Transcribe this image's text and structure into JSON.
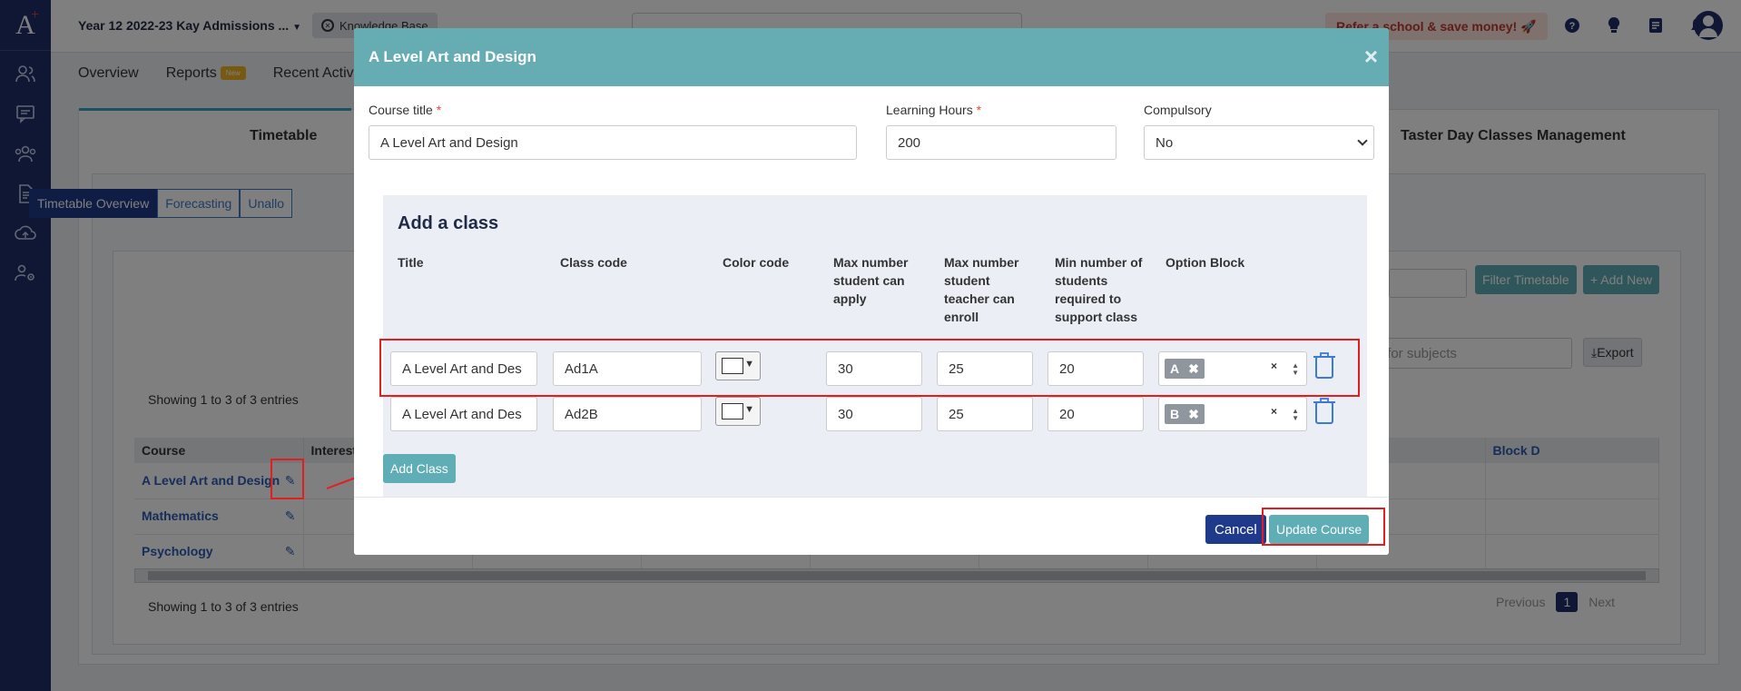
{
  "app": {
    "logo": "A",
    "logo_plus": "+"
  },
  "topbar": {
    "title": "Year 12 2022-23 Kay Admissions ...",
    "knowledge_base": "Knowledge Base",
    "refer": "Refer a school & save money! 🚀"
  },
  "nav": {
    "tabs": [
      "Overview",
      "Reports",
      "Recent Activ"
    ],
    "reports_badge": "New"
  },
  "background": {
    "tab_left": "Timetable",
    "tab_right": "Taster Day Classes Management",
    "subtabs": [
      "Timetable Overview",
      "Forecasting",
      "Unallo"
    ],
    "filter_button": "Filter Timetable",
    "add_new_button": "+ Add New",
    "subject_filter_placeholder": "r for subjects",
    "export_button": "Export",
    "showing": "Showing 1 to 3 of 3 entries",
    "columns": [
      "Course",
      "Interest",
      "Block D"
    ],
    "courses": [
      "A Level Art and Design",
      "Mathematics",
      "Psychology"
    ],
    "pager": {
      "previous": "Previous",
      "current": "1",
      "next": "Next"
    }
  },
  "modal": {
    "title": "A Level Art and Design",
    "course_title_label": "Course title",
    "course_title_value": "A Level Art and Design",
    "learning_hours_label": "Learning Hours",
    "learning_hours_value": "200",
    "compulsory_label": "Compulsory",
    "compulsory_value": "No",
    "required_mark": "*",
    "add_class_heading": "Add a class",
    "columns": {
      "title": "Title",
      "class_code": "Class code",
      "color_code": "Color code",
      "max_apply": "Max number student can apply",
      "max_enroll": "Max number student teacher can enroll",
      "min_support": "Min number of students required to support class",
      "option_block": "Option Block"
    },
    "rows": [
      {
        "title": "A Level Art and Des",
        "class_code": "Ad1A",
        "max_apply": "30",
        "max_enroll": "25",
        "min_support": "20",
        "option_block": "A"
      },
      {
        "title": "A Level Art and Des",
        "class_code": "Ad2B",
        "max_apply": "30",
        "max_enroll": "25",
        "min_support": "20",
        "option_block": "B"
      }
    ],
    "add_class_button": "Add Class",
    "cancel_button": "Cancel",
    "update_button": "Update Course"
  },
  "colors": {
    "sidebar": "#1f2f6b",
    "modal_header": "#66adb3",
    "primary_button": "#1f3a8a",
    "teal_button": "#5fadb5",
    "annotation": "#e41e1e"
  }
}
